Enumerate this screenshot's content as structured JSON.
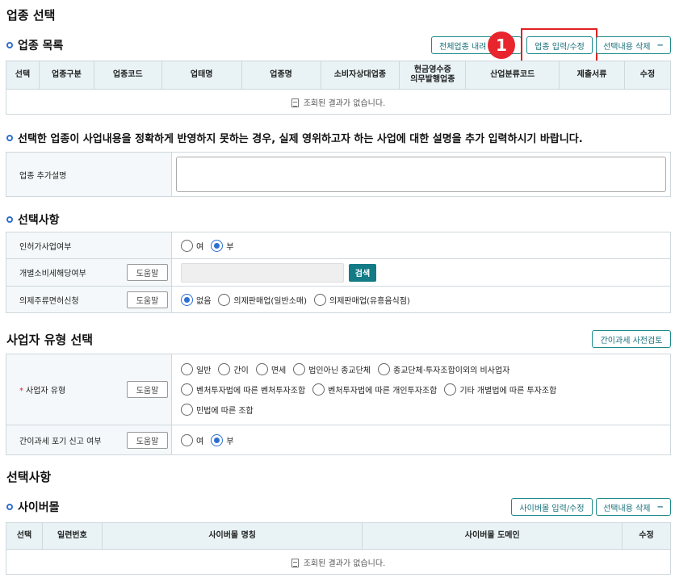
{
  "section1": {
    "title": "업종 선택",
    "list_title": "업종 목록",
    "buttons": {
      "all_load": "전체업종 내려",
      "input_edit": "업종 입력/수정",
      "delete_selected": "선택내용 삭제"
    },
    "badge": "1",
    "columns": [
      "선택",
      "업종구분",
      "업종코드",
      "업태명",
      "업종명",
      "소비자상대업종",
      "현금영수증\n의무발행업종",
      "산업분류코드",
      "제출서류",
      "수정"
    ],
    "empty_text": "조회된 결과가 없습니다."
  },
  "notice": "선택한 업종이 사업내용을 정확하게 반영하지 못하는 경우, 실제 영위하고자 하는 사업에 대한 설명을 추가 입력하시기 바랍니다.",
  "extra_desc": {
    "label": "업종 추가설명",
    "value": ""
  },
  "selection": {
    "title": "선택사항",
    "rows": {
      "permit": {
        "label": "인허가사업여부",
        "options": [
          "여",
          "부"
        ],
        "selected": "부"
      },
      "excise": {
        "label": "개별소비세해당여부",
        "help": "도움말",
        "search": "검색",
        "value": ""
      },
      "liquor": {
        "label": "의제주류면허신청",
        "help": "도움말",
        "options": [
          "없음",
          "의제판매업(일반소매)",
          "의제판매업(유흥음식점)"
        ],
        "selected": "없음"
      }
    }
  },
  "biz_type": {
    "title": "사업자 유형 선택",
    "precheck_button": "간이과세 사전검토",
    "type_row": {
      "label": "사업자 유형",
      "required_mark": "*",
      "help": "도움말",
      "options_line1": [
        "일반",
        "간이",
        "면세",
        "법인아닌 종교단체",
        "종교단체·투자조합이외의 비사업자"
      ],
      "options_line2": [
        "벤처투자법에 따른 벤처투자조합",
        "벤처투자법에 따른 개인투자조합",
        "기타 개별법에 따른 투자조합"
      ],
      "options_line3": [
        "민법에 따른 조합"
      ]
    },
    "waiver_row": {
      "label": "간이과세 포기 신고 여부",
      "help": "도움말",
      "options": [
        "여",
        "부"
      ],
      "selected": "부"
    }
  },
  "section2": {
    "title": "선택사항",
    "cyber_title": "사이버몰",
    "buttons": {
      "input_edit": "사이버몰 입력/수정",
      "delete_selected": "선택내용 삭제"
    },
    "columns": [
      "선택",
      "일련번호",
      "사이버몰 명칭",
      "사이버몰 도메인",
      "수정"
    ],
    "empty_text": "조회된 결과가 없습니다."
  },
  "colors": {
    "accent": "#2d6fd1",
    "teal": "#17707a",
    "search_btn": "#127b86",
    "badge_red": "#e8242c",
    "highlight": "#e02020"
  }
}
